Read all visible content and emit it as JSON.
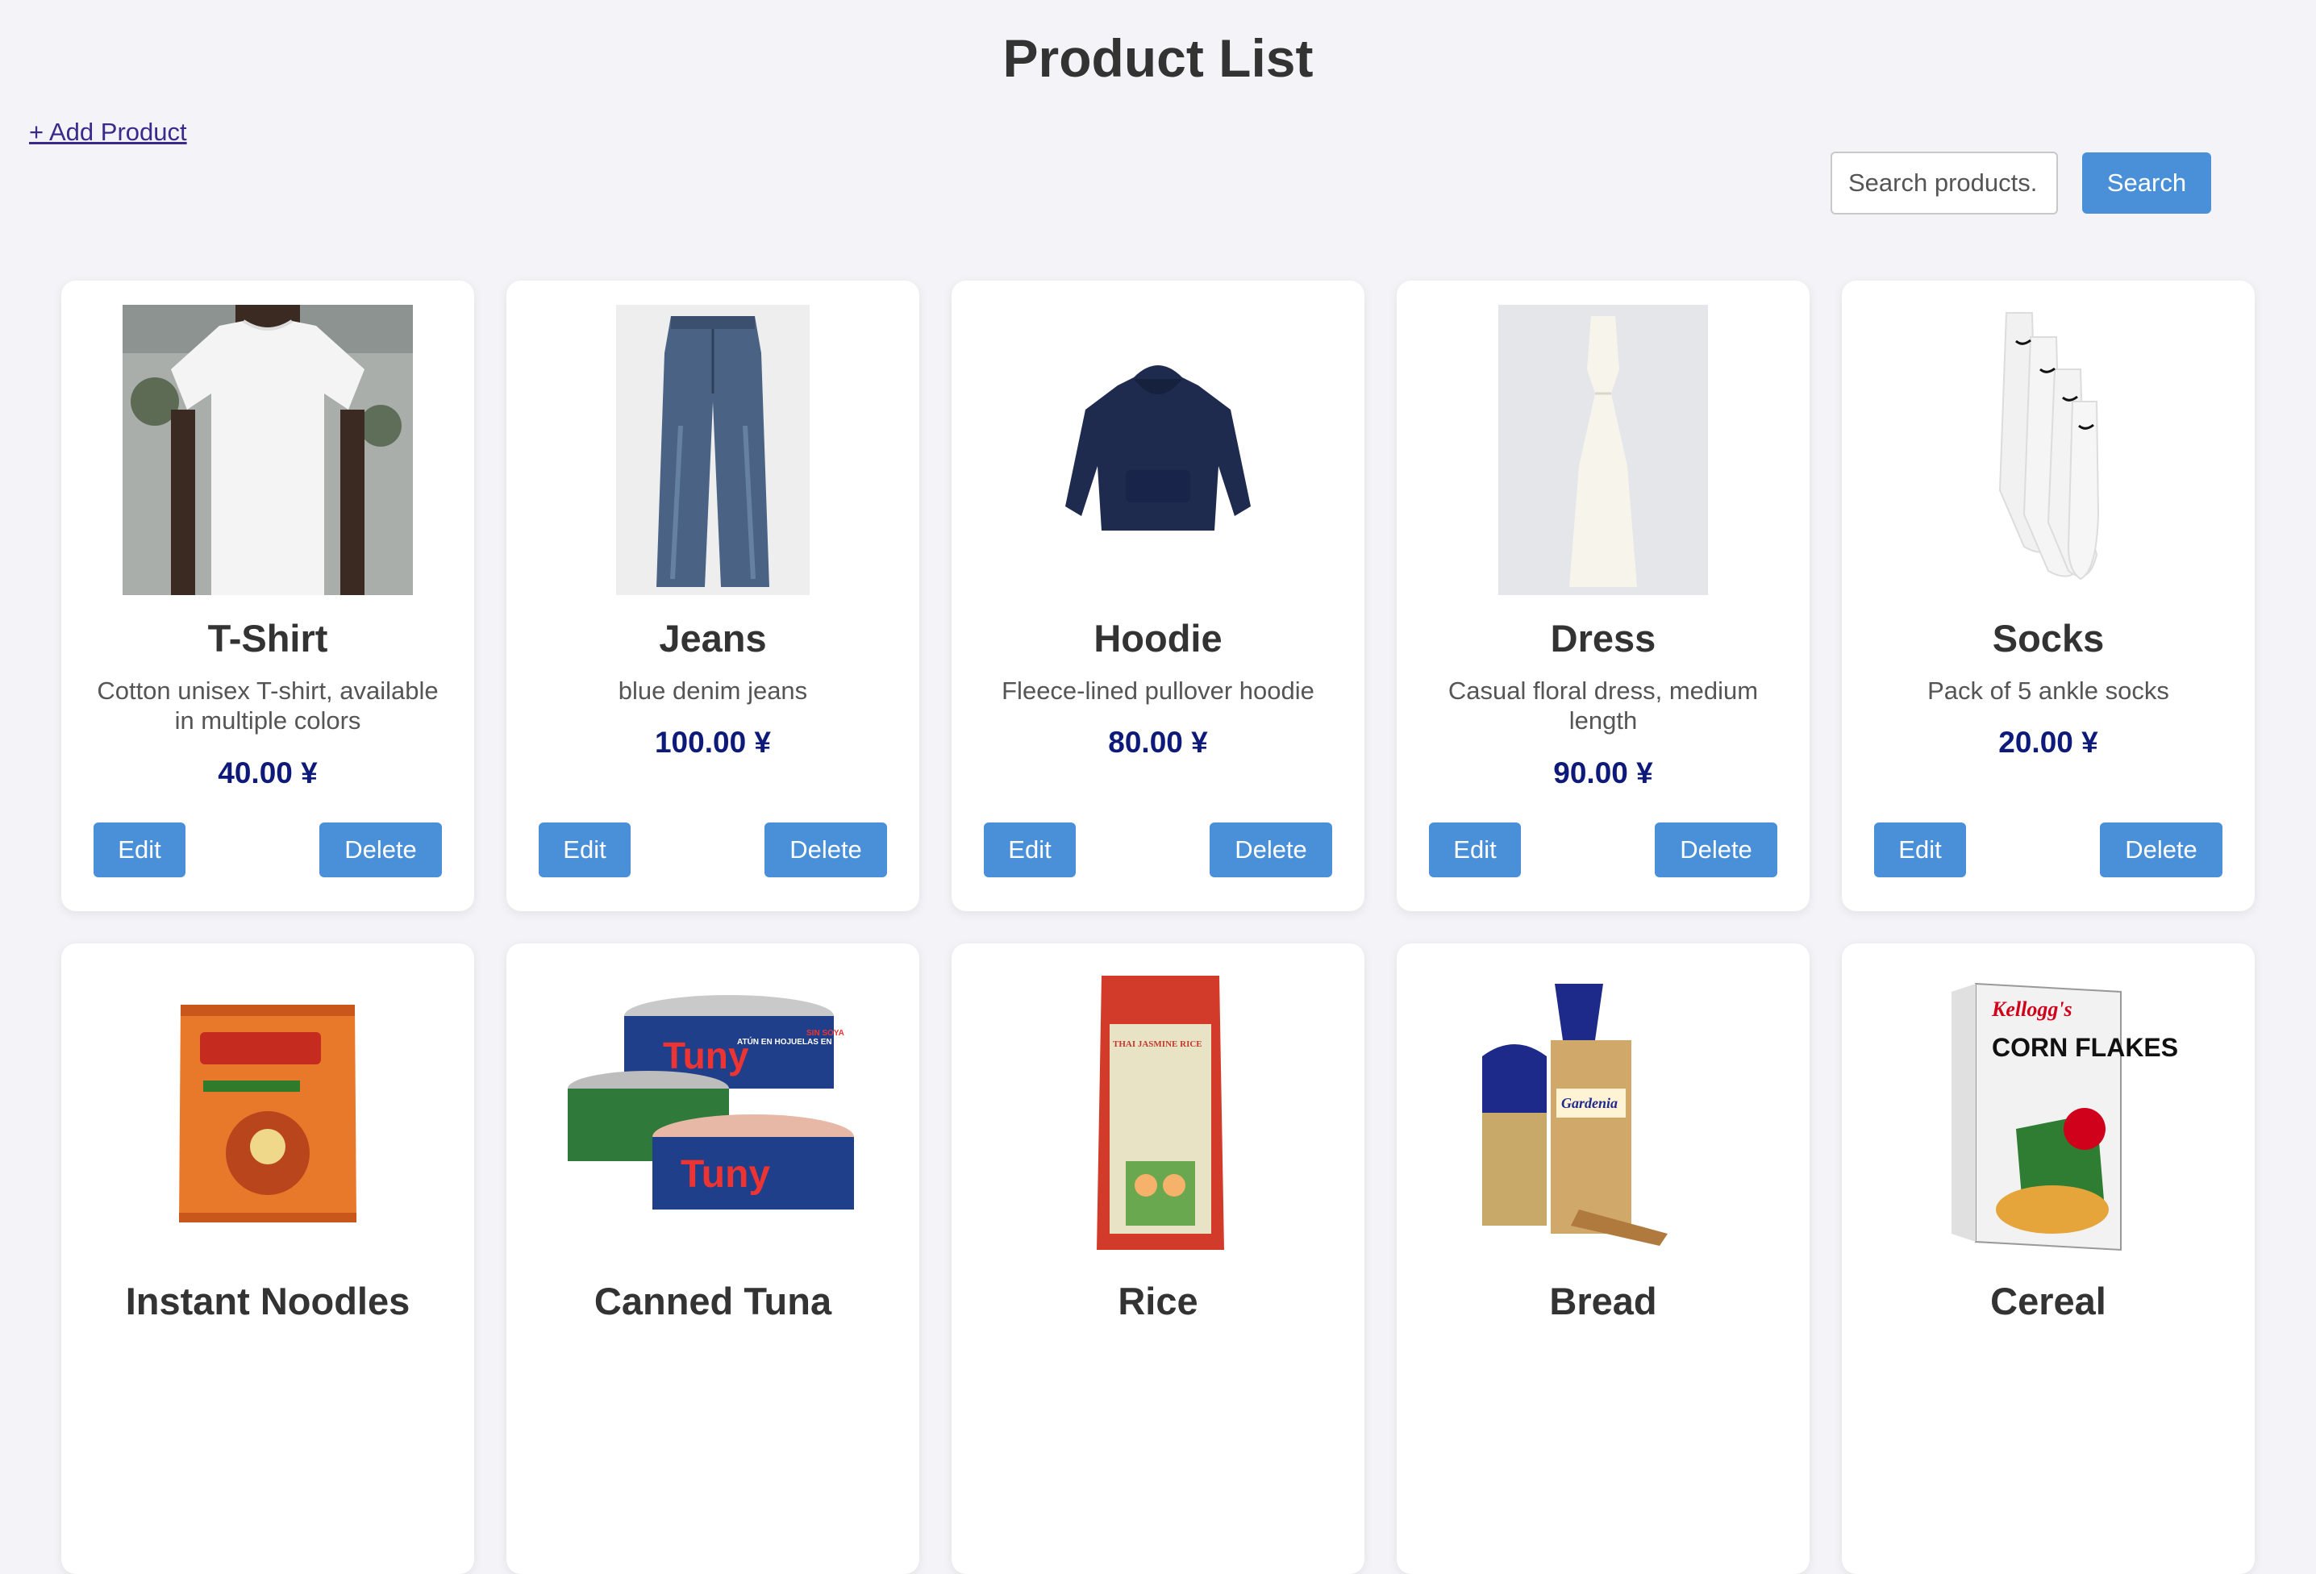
{
  "header": {
    "title": "Product List"
  },
  "actions": {
    "add_product": "+ Add Product"
  },
  "search": {
    "placeholder": "Search products.",
    "button": "Search"
  },
  "buttons": {
    "edit": "Edit",
    "delete": "Delete"
  },
  "products": [
    {
      "name": "T-Shirt",
      "description": "Cotton unisex T-shirt, available in multiple colors",
      "price": "40.00 ¥",
      "image": "tshirt-photo"
    },
    {
      "name": "Jeans",
      "description": "blue denim jeans",
      "price": "100.00 ¥",
      "image": "jeans-photo"
    },
    {
      "name": "Hoodie",
      "description": "Fleece-lined pullover hoodie",
      "price": "80.00 ¥",
      "image": "hoodie-photo"
    },
    {
      "name": "Dress",
      "description": "Casual floral dress, medium length",
      "price": "90.00 ¥",
      "image": "dress-photo"
    },
    {
      "name": "Socks",
      "description": "Pack of 5 ankle socks",
      "price": "20.00 ¥",
      "image": "socks-photo"
    },
    {
      "name": "Instant Noodles",
      "image": "noodles-package-photo"
    },
    {
      "name": "Canned Tuna",
      "image": "tuna-cans-photo",
      "package_text": [
        "Tuny",
        "ATÚN EN HOJUELAS EN AGUA",
        "SIN SOYA"
      ]
    },
    {
      "name": "Rice",
      "image": "rice-bag-photo",
      "package_text": [
        "THAI JASMINE RICE"
      ]
    },
    {
      "name": "Bread",
      "image": "bread-loaves-photo",
      "package_text": [
        "Gardenia"
      ]
    },
    {
      "name": "Cereal",
      "image": "cereal-box-photo",
      "package_text": [
        "Kellogg's",
        "CORN FLAKES"
      ]
    }
  ]
}
